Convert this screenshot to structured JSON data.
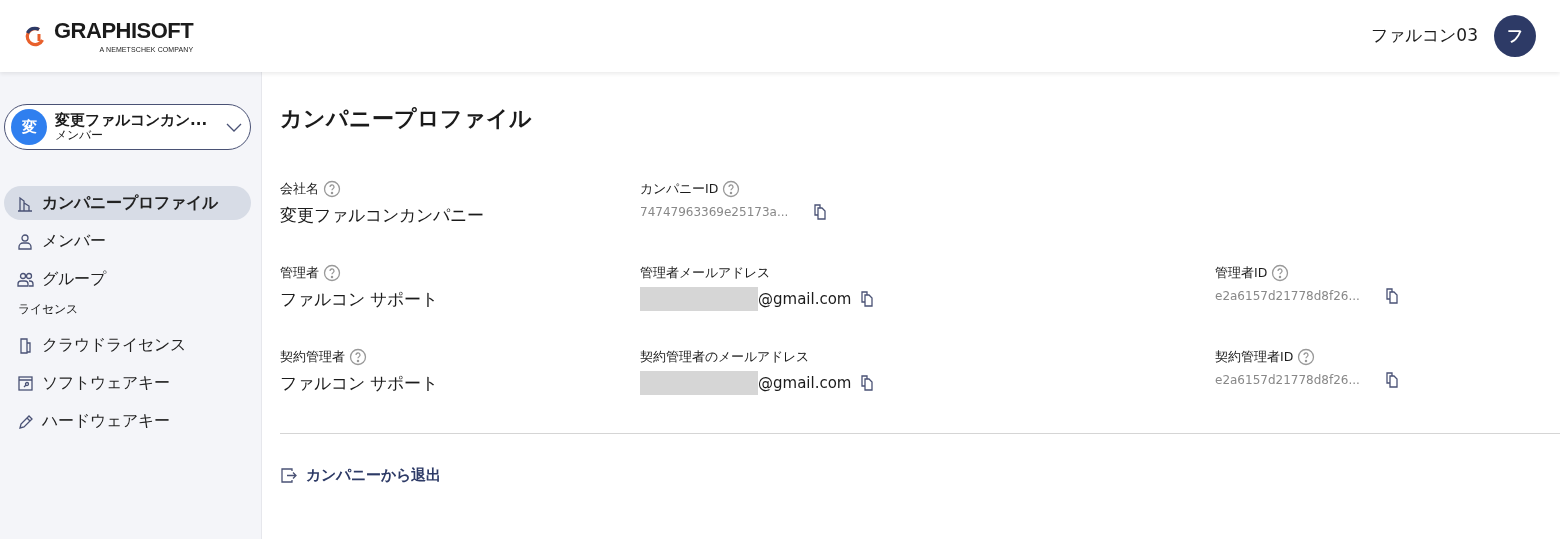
{
  "header": {
    "logo": "GRAPHISOFT",
    "logo_tagline": "A NEMETSCHEK COMPANY",
    "user_name": "ファルコン03",
    "user_initial": "フ"
  },
  "sidebar": {
    "company": {
      "initial": "変",
      "name": "変更ファルコンカン...",
      "role": "メンバー"
    },
    "items": [
      {
        "label": "カンパニープロファイル",
        "selected": true
      },
      {
        "label": "メンバー",
        "selected": false
      },
      {
        "label": "グループ",
        "selected": false
      },
      {
        "kind": "section",
        "label": "ライセンス"
      },
      {
        "label": "クラウドライセンス",
        "selected": false
      },
      {
        "label": "ソフトウェアキー",
        "selected": false
      },
      {
        "label": "ハードウェアキー",
        "selected": false
      }
    ]
  },
  "page": {
    "title": "カンパニープロファイル",
    "rows": [
      [
        {
          "label": "会社名",
          "help": true,
          "kind": "text",
          "value": "変更ファルコンカンパニー",
          "copy": false
        },
        {
          "label": "カンパニーID",
          "help": true,
          "kind": "id",
          "value": "74747963369e25173a...",
          "copy": true
        },
        null
      ],
      [
        {
          "label": "管理者",
          "help": true,
          "kind": "text",
          "value": "ファルコン サポート",
          "copy": false
        },
        {
          "label": "管理者メールアドレス",
          "help": false,
          "kind": "email",
          "redacted": true,
          "value": "@gmail.com",
          "copy": true
        },
        {
          "label": "管理者ID",
          "help": true,
          "kind": "id",
          "value": "e2a6157d21778d8f26...",
          "copy": true
        }
      ],
      [
        {
          "label": "契約管理者",
          "help": true,
          "kind": "text",
          "value": "ファルコン サポート",
          "copy": false
        },
        {
          "label": "契約管理者のメールアドレス",
          "help": false,
          "kind": "email",
          "redacted": true,
          "value": "@gmail.com",
          "copy": true
        },
        {
          "label": "契約管理者ID",
          "help": true,
          "kind": "id",
          "value": "e2a6157d21778d8f26...",
          "copy": true
        }
      ]
    ],
    "leave_link": "カンパニーから退出"
  }
}
